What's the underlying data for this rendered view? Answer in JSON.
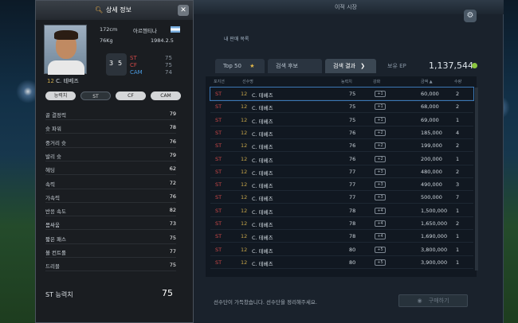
{
  "window": {
    "title": "이적 시장"
  },
  "menu": {
    "label": "내 판매 목록"
  },
  "tabs": [
    {
      "label": "Top 50",
      "active": false
    },
    {
      "label": "검색 후보",
      "active": false
    },
    {
      "label": "검색 결과",
      "active": true
    },
    {
      "label": "보유 EP",
      "active": false
    }
  ],
  "balance": {
    "value": "1,137,544"
  },
  "list": {
    "headers": [
      "포지션",
      "선수명",
      "능력치",
      "강화",
      "금액 ▲",
      "수량"
    ],
    "rows": [
      {
        "pos": "ST",
        "flag": "12",
        "name": "C. 테베즈",
        "ovr": "75",
        "up": "+1",
        "price": "60,000",
        "qty": "2"
      },
      {
        "pos": "ST",
        "flag": "12",
        "name": "C. 테베즈",
        "ovr": "75",
        "up": "+1",
        "price": "68,000",
        "qty": "2"
      },
      {
        "pos": "ST",
        "flag": "12",
        "name": "C. 테베즈",
        "ovr": "75",
        "up": "+1",
        "price": "69,000",
        "qty": "1"
      },
      {
        "pos": "ST",
        "flag": "12",
        "name": "C. 테베즈",
        "ovr": "76",
        "up": "+2",
        "price": "185,000",
        "qty": "4"
      },
      {
        "pos": "ST",
        "flag": "12",
        "name": "C. 테베즈",
        "ovr": "76",
        "up": "+2",
        "price": "199,000",
        "qty": "2"
      },
      {
        "pos": "ST",
        "flag": "12",
        "name": "C. 테베즈",
        "ovr": "76",
        "up": "+2",
        "price": "200,000",
        "qty": "1"
      },
      {
        "pos": "ST",
        "flag": "12",
        "name": "C. 테베즈",
        "ovr": "77",
        "up": "+3",
        "price": "480,000",
        "qty": "2"
      },
      {
        "pos": "ST",
        "flag": "12",
        "name": "C. 테베즈",
        "ovr": "77",
        "up": "+3",
        "price": "490,000",
        "qty": "3"
      },
      {
        "pos": "ST",
        "flag": "12",
        "name": "C. 테베즈",
        "ovr": "77",
        "up": "+3",
        "price": "500,000",
        "qty": "7"
      },
      {
        "pos": "ST",
        "flag": "12",
        "name": "C. 테베즈",
        "ovr": "78",
        "up": "+4",
        "price": "1,500,000",
        "qty": "1"
      },
      {
        "pos": "ST",
        "flag": "12",
        "name": "C. 테베즈",
        "ovr": "78",
        "up": "+4",
        "price": "1,650,000",
        "qty": "2"
      },
      {
        "pos": "ST",
        "flag": "12",
        "name": "C. 테베즈",
        "ovr": "78",
        "up": "+4",
        "price": "1,690,000",
        "qty": "1"
      },
      {
        "pos": "ST",
        "flag": "12",
        "name": "C. 테베즈",
        "ovr": "80",
        "up": "+5",
        "price": "3,800,000",
        "qty": "1"
      },
      {
        "pos": "ST",
        "flag": "12",
        "name": "C. 테베즈",
        "ovr": "80",
        "up": "+5",
        "price": "3,900,000",
        "qty": "1"
      }
    ]
  },
  "footer": {
    "notice": "선수단이 가득찼습니다. 선수단을 정리해주세요.",
    "buy_label": "구매하기"
  },
  "detail": {
    "title": "상세 정보",
    "height": "172cm",
    "weight": "76Kg",
    "nation": "아르헨티나",
    "birth": "1984.2.5",
    "boot_left": "3",
    "boot_right": "5",
    "flag": "12",
    "name": "C. 테베즈",
    "pos_stats": [
      {
        "pos": "ST",
        "val": "75"
      },
      {
        "pos": "CF",
        "val": "75"
      },
      {
        "pos": "CAM",
        "val": "74"
      }
    ],
    "pos_buttons": [
      "능력치",
      "ST",
      "CF",
      "CAM"
    ],
    "attrs": [
      {
        "name": "골 결정력",
        "val": "79"
      },
      {
        "name": "슛 파워",
        "val": "78"
      },
      {
        "name": "중거리 슛",
        "val": "76"
      },
      {
        "name": "발리 슛",
        "val": "79"
      },
      {
        "name": "헤딩",
        "val": "62"
      },
      {
        "name": "속력",
        "val": "72"
      },
      {
        "name": "가속력",
        "val": "76"
      },
      {
        "name": "반응 속도",
        "val": "82"
      },
      {
        "name": "몸싸움",
        "val": "73"
      },
      {
        "name": "짧은 패스",
        "val": "75"
      },
      {
        "name": "볼 컨트롤",
        "val": "77"
      },
      {
        "name": "드리블",
        "val": "75"
      }
    ],
    "summary_label": "ST 능력치",
    "summary_value": "75"
  }
}
